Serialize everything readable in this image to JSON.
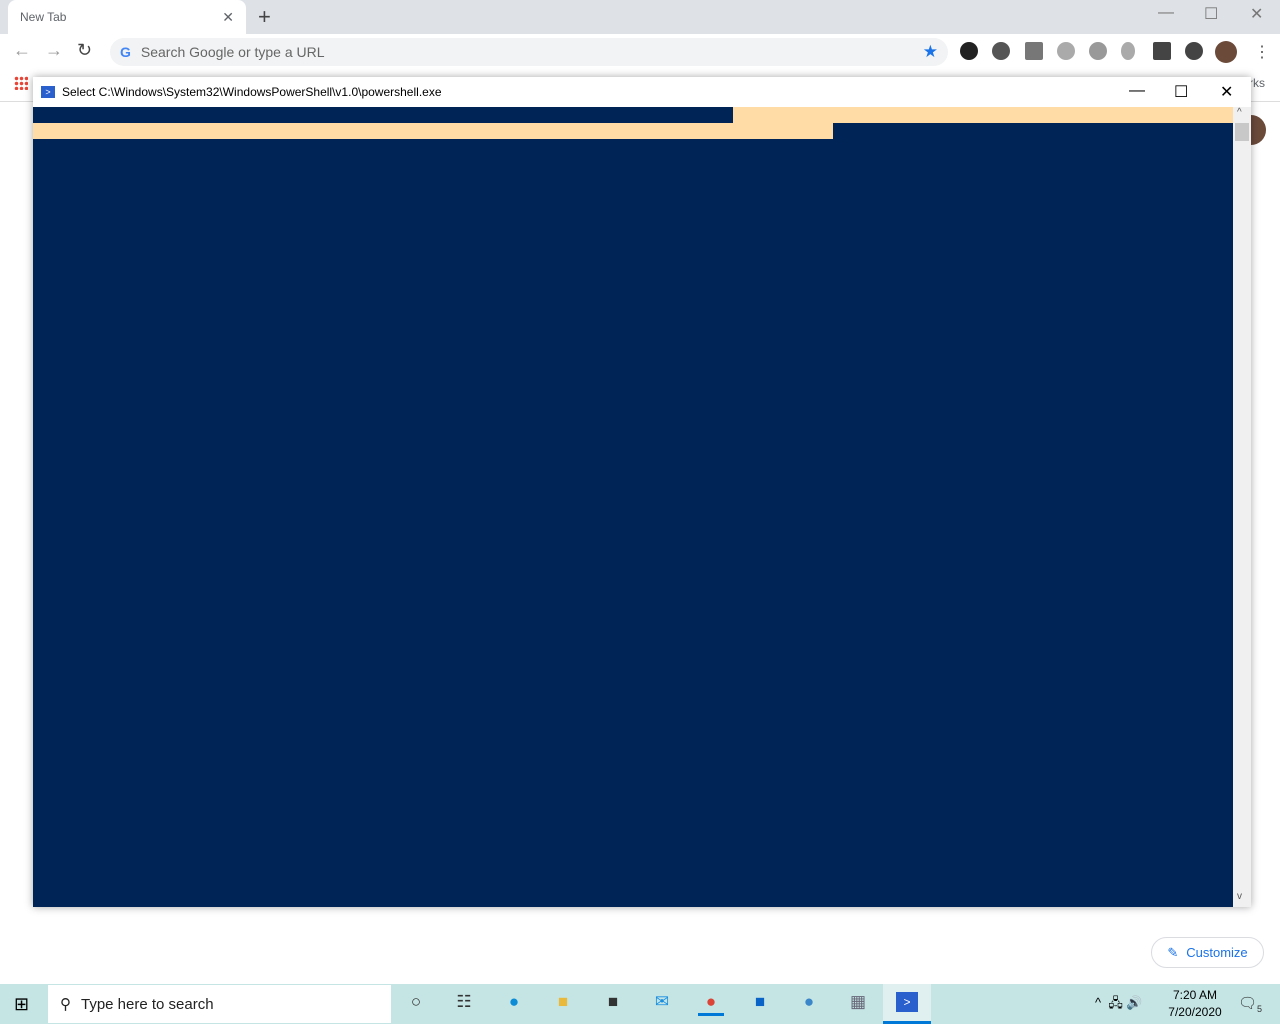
{
  "browser": {
    "tab_title": "New Tab",
    "omnibox_placeholder": "Search Google or type a URL",
    "bookmarks_partial": "rks",
    "customize_label": "Customize"
  },
  "icons": {
    "back": "←",
    "forward": "→",
    "reload": "↻",
    "star": "★",
    "close": "✕",
    "new_tab": "+",
    "minimize": "—",
    "maximize": "☐",
    "menu": "⋮"
  },
  "powershell": {
    "title": "Select C:\\Windows\\System32\\WindowsPowerShell\\v1.0\\powershell.exe",
    "background": "#012456",
    "selection": "#ffdba6"
  },
  "taskbar": {
    "search_placeholder": "Type here to search",
    "time": "7:20 AM",
    "date": "7/20/2020",
    "notification_count": "5"
  }
}
